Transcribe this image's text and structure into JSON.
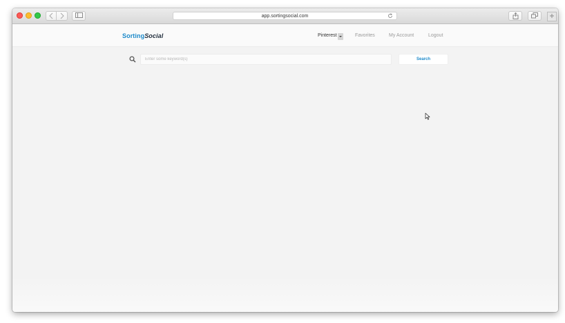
{
  "browser": {
    "address": "app.sortingsocial.com"
  },
  "app": {
    "logo_part1": "Sorting",
    "logo_part2": "Social",
    "nav": {
      "network": "Pinterest",
      "favorites": "Favorites",
      "my_account": "My Account",
      "logout": "Logout"
    },
    "search": {
      "placeholder": "Enter some keyword(s)",
      "button_label": "Search"
    }
  },
  "icons": {
    "back": "chevron-left-icon",
    "forward": "chevron-right-icon",
    "sidebar": "sidebar-icon",
    "reload": "reload-icon",
    "share": "share-icon",
    "tabs": "tabs-icon",
    "new_tab": "plus-icon",
    "search": "search-icon",
    "dropdown": "caret-down-icon",
    "cursor": "mouse-pointer-icon"
  },
  "colors": {
    "brand_blue": "#1a88c9",
    "brand_dark": "#1e2b3a",
    "page_bg": "#f3f3f3"
  }
}
